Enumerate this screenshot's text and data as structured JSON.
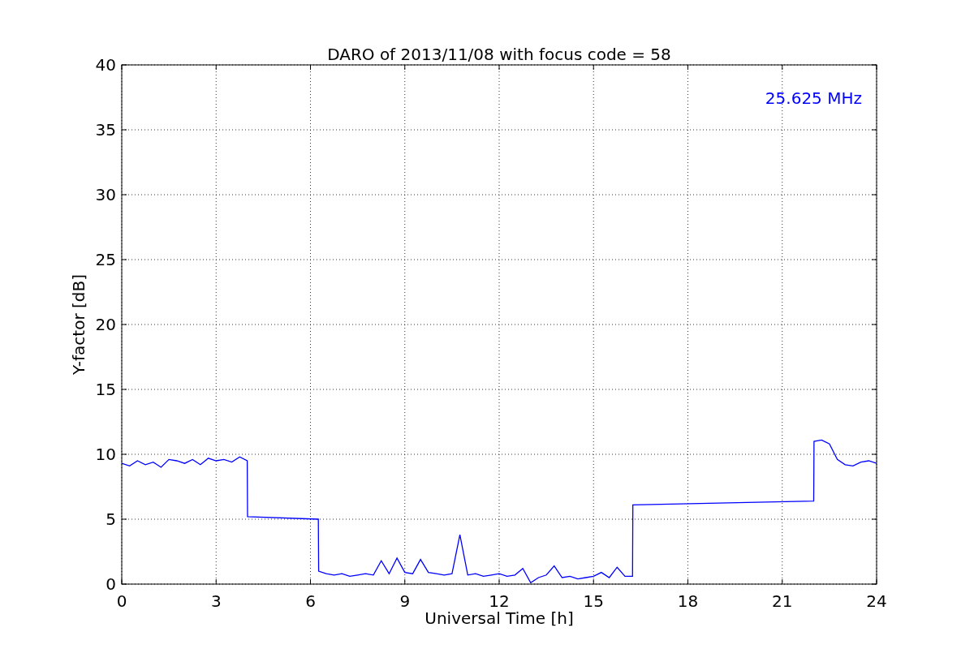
{
  "chart_data": {
    "type": "line",
    "title": "DARO of 2013/11/08 with focus code = 58",
    "xlabel": "Universal Time [h]",
    "ylabel": "Y-factor [dB]",
    "x": [
      0,
      0.25,
      0.5,
      0.75,
      1,
      1.25,
      1.5,
      1.75,
      2,
      2.25,
      2.5,
      2.75,
      3,
      3.25,
      3.5,
      3.75,
      3.99,
      4,
      6.25,
      6.26,
      6.5,
      6.75,
      7,
      7.25,
      7.5,
      7.75,
      8,
      8.25,
      8.5,
      8.75,
      9,
      9.25,
      9.5,
      9.75,
      10,
      10.25,
      10.5,
      10.75,
      11,
      11.25,
      11.5,
      11.75,
      12,
      12.25,
      12.5,
      12.75,
      13,
      13.25,
      13.5,
      13.75,
      14,
      14.25,
      14.5,
      14.75,
      15,
      15.25,
      15.5,
      15.75,
      16,
      16.24,
      16.25,
      22,
      22.01,
      22.25,
      22.5,
      22.75,
      23,
      23.25,
      23.5,
      23.75,
      24
    ],
    "series": [
      {
        "name": "25.625 MHz",
        "color": "#0000ff",
        "values": [
          9.3,
          9.1,
          9.5,
          9.2,
          9.4,
          9.0,
          9.6,
          9.5,
          9.3,
          9.6,
          9.2,
          9.7,
          9.5,
          9.6,
          9.4,
          9.8,
          9.5,
          5.2,
          5.0,
          1.0,
          0.8,
          0.7,
          0.8,
          0.6,
          0.7,
          0.8,
          0.7,
          1.8,
          0.8,
          2.0,
          0.9,
          0.8,
          1.9,
          0.9,
          0.8,
          0.7,
          0.8,
          3.8,
          0.7,
          0.8,
          0.6,
          0.7,
          0.8,
          0.6,
          0.7,
          1.2,
          0.1,
          0.5,
          0.7,
          1.4,
          0.5,
          0.6,
          0.4,
          0.5,
          0.6,
          0.9,
          0.5,
          1.3,
          0.6,
          0.6,
          6.1,
          6.4,
          11.0,
          11.1,
          10.8,
          9.6,
          9.2,
          9.1,
          9.4,
          9.5,
          9.3
        ]
      }
    ],
    "xlim": [
      0,
      24
    ],
    "ylim": [
      0,
      40
    ],
    "xticks": [
      0,
      3,
      6,
      9,
      12,
      15,
      18,
      21,
      24
    ],
    "yticks": [
      0,
      5,
      10,
      15,
      20,
      25,
      30,
      35,
      40
    ],
    "grid": true
  }
}
